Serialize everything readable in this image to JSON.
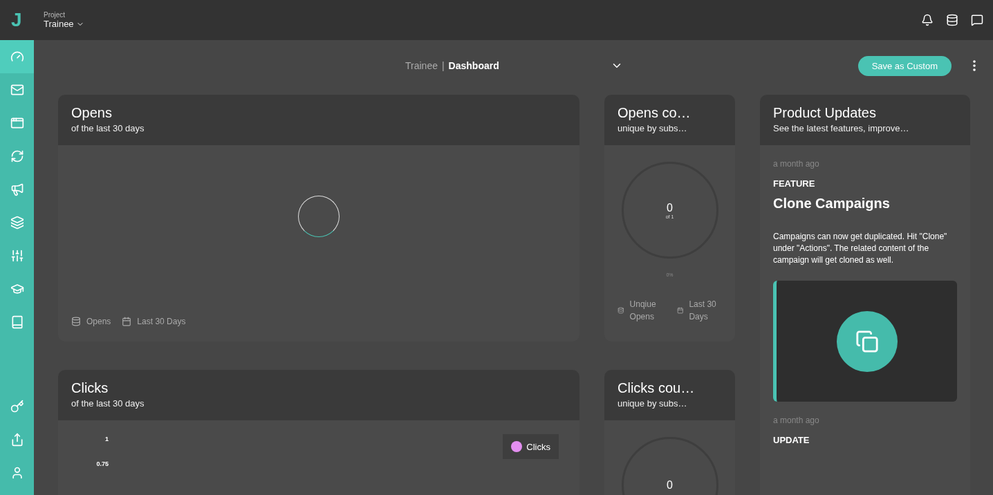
{
  "topbar": {
    "logo": "J",
    "project_label": "Project",
    "project_name": "Trainee"
  },
  "sidebar": {
    "items": [
      {
        "selected": true
      },
      {
        "selected": false
      },
      {
        "selected": false
      },
      {
        "selected": false
      },
      {
        "selected": false
      },
      {
        "selected": false
      },
      {
        "selected": false
      },
      {
        "selected": false
      },
      {
        "selected": false
      }
    ],
    "bottom_items": [
      {
        "selected": false
      },
      {
        "selected": false
      },
      {
        "selected": false
      }
    ]
  },
  "toolbar": {
    "project": "Trainee",
    "separator": "|",
    "dashboard": "Dashboard",
    "save_button": "Save as Custom"
  },
  "cards": [
    {
      "kind": "line",
      "title": "Opens",
      "subtitle": "of the last 30 days",
      "loading": true,
      "footer": [
        {
          "kind": "source",
          "label": "Opens"
        },
        {
          "kind": "period",
          "label": "Last 30 Days"
        }
      ]
    },
    {
      "kind": "count",
      "title": "Opens co…",
      "subtitle": "unique by subs…",
      "value": "0",
      "of": "of 1",
      "percent": "0%",
      "footer": [
        {
          "kind": "source",
          "label": "Unqiue Opens"
        },
        {
          "kind": "period",
          "label": "Last 30 Days"
        }
      ]
    },
    {
      "kind": "updates",
      "title": "Product Updates",
      "subtitle": "See the latest features, improve…",
      "entries": [
        {
          "time": "a month ago",
          "label": "FEATURE",
          "title": "Clone Campaigns",
          "text": "Campaigns can now get duplicated. Hit \"Clone\" under \"Actions\". The related content of the campaign will get cloned as well.",
          "image": true
        },
        {
          "time": "a month ago",
          "label": "UPDATE"
        }
      ]
    },
    {
      "kind": "line",
      "title": "Clicks",
      "subtitle": "of the last 30 days",
      "y_ticks": [
        "1",
        "0.75"
      ],
      "legend": [
        {
          "label": "Clicks",
          "color": "#e38ff0"
        }
      ]
    },
    {
      "kind": "count",
      "title": "Clicks cou…",
      "subtitle": "unique by subs…",
      "value": "0"
    }
  ]
}
